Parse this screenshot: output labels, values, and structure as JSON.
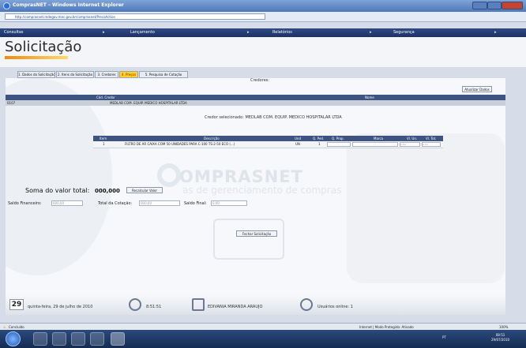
{
  "window": {
    "title": "ComprasNET – Windows Internet Explorer",
    "url": "http://comprasnet.redegov.mec.gov.br/comprasnet/PrecoAction"
  },
  "menu": [
    {
      "label": "Consultas"
    },
    {
      "label": "Lançamento"
    },
    {
      "label": "Relatórios"
    },
    {
      "label": "Segurança"
    }
  ],
  "page": {
    "title": "Solicitação",
    "tabs": [
      "1. Dados da Solicitação",
      "2. Itens da Solicitação",
      "3. Credores",
      "4. Preços",
      "5. Pesquisa de Cotação"
    ],
    "active_tab": "4. Preços"
  },
  "credores": {
    "label": "Credores:",
    "update_button": "Atualizar Dados",
    "columns": [
      "Cód. Credor",
      "Nome"
    ],
    "rows": [
      {
        "code": "0107",
        "name": "MEDLAB COM. EQUIP. MEDICO HOSPITALAR LTDA"
      }
    ],
    "selected_text": "Credor selecionado: MEDLAB COM. EQUIP. MEDICO HOSPITALAR LTDA"
  },
  "items": {
    "columns": [
      "Item",
      "Descrição",
      "Und",
      "Q. Ped.",
      "Q. Prop.",
      "Marca",
      "Vl. Un.",
      "Vl. Tot."
    ],
    "rows": [
      {
        "item": "1",
        "desc": "FILTRO DE AR CAIXA COM 50 UNIDADES PARA C-100 TS-2-50 ECO (...)",
        "und": "UN",
        "qped": "1",
        "qprop": "",
        "marca": "",
        "vlun": "0,00",
        "vltot": "0,00"
      }
    ]
  },
  "summary": {
    "soma_label": "Soma do valor total:",
    "soma_value": "000,000",
    "recalc_button": "Recalcular Valor",
    "fields": [
      {
        "label": "Saldo Financeiro:",
        "value": "000,00"
      },
      {
        "label": "Total da Cotação:",
        "value": "000,00"
      },
      {
        "label": "Saldo Final:",
        "value": "0,00"
      }
    ],
    "close_button": "Fechar Solicitação"
  },
  "watermark": {
    "brand": "OMPRASNET",
    "subtitle": "as de gerenciamento de compras"
  },
  "footer": {
    "day": "29",
    "date": "quinta-feira, 29 de julho de 2010",
    "time": "8:51:51",
    "user": "EDIVANIA MIRANDA ARAUJO",
    "online": "Usuários online: 1"
  },
  "statusbar": {
    "left": "Concluído",
    "zone": "Internet | Modo Protegido: Ativado",
    "zoom": "100%"
  },
  "taskbar": {
    "tray": "PT",
    "clock_time": "08:51",
    "clock_date": "29/07/2010"
  },
  "colors": {
    "menu": "#1d3164",
    "active_tab": "#ffd32a",
    "table_head": "#3d5483",
    "accent": "#f08a10"
  }
}
